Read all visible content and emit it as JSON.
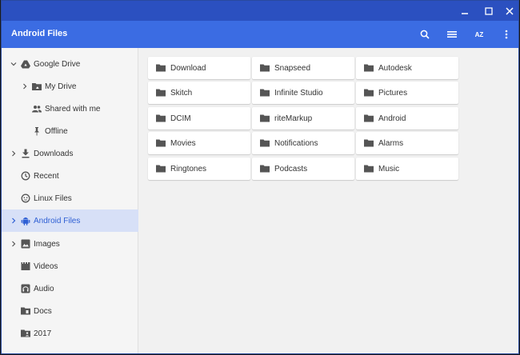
{
  "app": {
    "title": "Android Files"
  },
  "toolbar": {
    "search_icon": "search-icon",
    "view_icon": "list-view-icon",
    "sort_label": "AZ",
    "more_icon": "more-vert-icon"
  },
  "window_controls": {
    "minimize": "minimize-icon",
    "maximize": "maximize-icon",
    "close": "close-icon"
  },
  "sidebar": {
    "items": [
      {
        "label": "Google Drive",
        "icon": "drive-icon",
        "expand": "expanded"
      },
      {
        "label": "My Drive",
        "icon": "folder-drive-icon",
        "expand": "collapsed"
      },
      {
        "label": "Shared with me",
        "icon": "people-icon",
        "expand": "none"
      },
      {
        "label": "Offline",
        "icon": "pin-icon",
        "expand": "none"
      },
      {
        "label": "Downloads",
        "icon": "download-icon",
        "expand": "collapsed"
      },
      {
        "label": "Recent",
        "icon": "clock-icon",
        "expand": "none"
      },
      {
        "label": "Linux Files",
        "icon": "linux-icon",
        "expand": "none"
      },
      {
        "label": "Android Files",
        "icon": "android-icon",
        "expand": "collapsed",
        "selected": true
      },
      {
        "label": "Images",
        "icon": "image-icon",
        "expand": "collapsed"
      },
      {
        "label": "Videos",
        "icon": "video-icon",
        "expand": "none"
      },
      {
        "label": "Audio",
        "icon": "audio-icon",
        "expand": "none"
      },
      {
        "label": "Docs",
        "icon": "docs-folder-icon",
        "expand": "none"
      },
      {
        "label": "2017",
        "icon": "folder-shared-icon",
        "expand": "none"
      }
    ]
  },
  "folders": [
    "Download",
    "Snapseed",
    "Autodesk",
    "Skitch",
    "Infinite Studio",
    "Pictures",
    "DCIM",
    "riteMarkup",
    "Android",
    "Movies",
    "Notifications",
    "Alarms",
    "Ringtones",
    "Podcasts",
    "Music"
  ],
  "colors": {
    "titlebar": "#2b50c0",
    "appbar": "#3b6ce3",
    "selected_bg": "#d7e0f7",
    "selected_text": "#2e5fd4"
  }
}
